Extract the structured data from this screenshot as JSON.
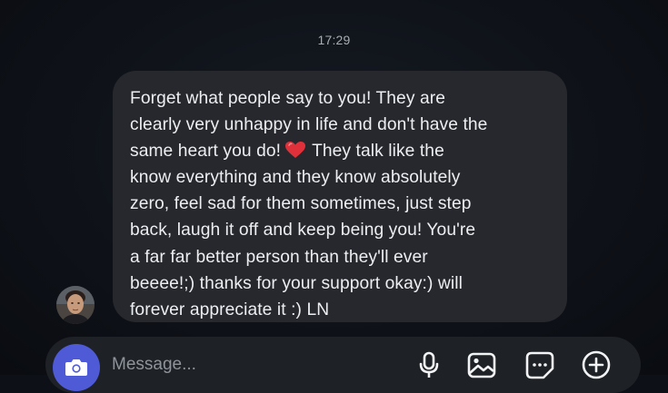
{
  "conversation": {
    "timestamp": "17:29",
    "message": {
      "lines": [
        "Forget what people say to you! They are",
        "clearly very unhappy in life and don't have the",
        "same heart you do!",
        "They talk like the",
        "know everything and they know absolutely",
        "zero, feel sad for them sometimes, just step",
        "back, laugh it off and keep being you! You're",
        "a far far better person than they'll ever",
        "beeee!;) thanks for your support okay:)  will",
        "forever appreciate it :) LN"
      ],
      "emoji": "red-heart-icon"
    }
  },
  "composer": {
    "placeholder": "Message...",
    "icons": [
      "camera-icon",
      "microphone-icon",
      "gallery-icon",
      "sticker-icon",
      "add-icon"
    ]
  },
  "colors": {
    "background": "#0d1016",
    "bubble": "#26282d",
    "text": "#eceef1",
    "accent": "#4e5ad6",
    "heart": "#e0313b"
  }
}
